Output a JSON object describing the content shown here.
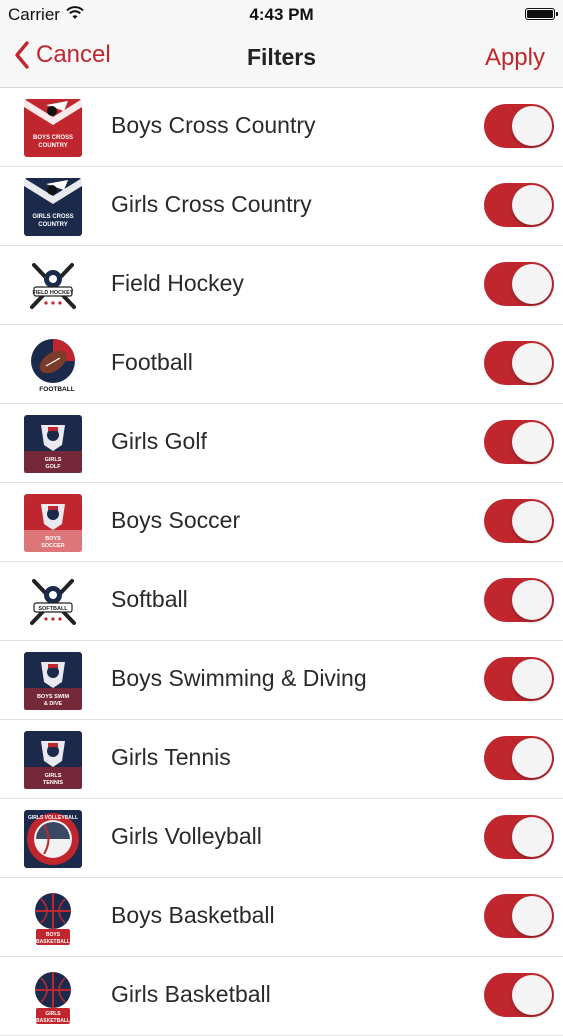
{
  "status_bar": {
    "carrier": "Carrier",
    "time": "4:43 PM"
  },
  "nav": {
    "back_label": "Cancel",
    "title": "Filters",
    "apply_label": "Apply"
  },
  "colors": {
    "accent": "#c0262d",
    "navy": "#1b2a4a",
    "red": "#c0262d"
  },
  "items": [
    {
      "name": "Boys Cross Country",
      "badge": "BOYS CROSS COUNTRY",
      "icon": "boys-cross-country-logo",
      "style": "red-shield",
      "on": true
    },
    {
      "name": "Girls Cross Country",
      "badge": "GIRLS CROSS COUNTRY",
      "icon": "girls-cross-country-logo",
      "style": "navy-shield",
      "on": true
    },
    {
      "name": "Field Hockey",
      "badge": "FIELD HOCKEY",
      "icon": "field-hockey-logo",
      "style": "crest",
      "on": true
    },
    {
      "name": "Football",
      "badge": "FOOTBALL",
      "icon": "football-logo",
      "style": "ball",
      "on": true
    },
    {
      "name": "Girls Golf",
      "badge": "GIRLS GOLF",
      "icon": "girls-golf-logo",
      "style": "navy-square",
      "on": true
    },
    {
      "name": "Boys Soccer",
      "badge": "BOYS SOCCER",
      "icon": "boys-soccer-logo",
      "style": "red-square",
      "on": true
    },
    {
      "name": "Softball",
      "badge": "SOFTBALL",
      "icon": "softball-logo",
      "style": "crest",
      "on": true
    },
    {
      "name": "Boys Swimming & Diving",
      "badge": "BOYS SWIM & DIVE",
      "icon": "boys-swim-dive-logo",
      "style": "navy-square",
      "on": true
    },
    {
      "name": "Girls Tennis",
      "badge": "GIRLS TENNIS",
      "icon": "girls-tennis-logo",
      "style": "navy-square",
      "on": true
    },
    {
      "name": "Girls Volleyball",
      "badge": "GIRLS VOLLEYBALL",
      "icon": "girls-volleyball-logo",
      "style": "ring",
      "on": true
    },
    {
      "name": "Boys Basketball",
      "badge": "BOYS BASKETBALL",
      "icon": "boys-basketball-logo",
      "style": "ball-navy",
      "on": true
    },
    {
      "name": "Girls Basketball",
      "badge": "GIRLS BASKETBALL",
      "icon": "girls-basketball-logo",
      "style": "ball-navy",
      "on": true
    }
  ]
}
